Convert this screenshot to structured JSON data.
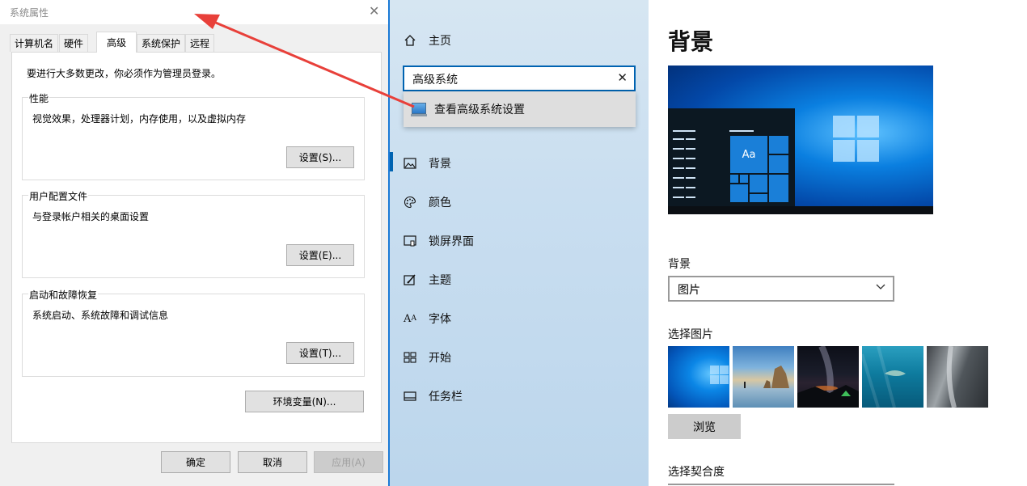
{
  "dialog": {
    "title": "系统属性",
    "tabs": [
      "计算机名",
      "硬件",
      "高级",
      "系统保护",
      "远程"
    ],
    "active_tab": "高级",
    "note": "要进行大多数更改，你必须作为管理员登录。",
    "groups": [
      {
        "title": "性能",
        "desc": "视觉效果，处理器计划，内存使用，以及虚拟内存",
        "button": "设置(S)..."
      },
      {
        "title": "用户配置文件",
        "desc": "与登录帐户相关的桌面设置",
        "button": "设置(E)..."
      },
      {
        "title": "启动和故障恢复",
        "desc": "系统启动、系统故障和调试信息",
        "button": "设置(T)..."
      }
    ],
    "env_button": "环境变量(N)...",
    "footer": {
      "ok": "确定",
      "cancel": "取消",
      "apply": "应用(A)"
    }
  },
  "settings": {
    "nav": {
      "home": "主页",
      "search_value": "高级系统",
      "suggestion": "查看高级系统设置",
      "items": [
        "背景",
        "颜色",
        "锁屏界面",
        "主题",
        "字体",
        "开始",
        "任务栏"
      ],
      "selected": "背景"
    },
    "main": {
      "heading": "背景",
      "preview_tile": "Aa",
      "background_label": "背景",
      "background_value": "图片",
      "choose_picture_label": "选择图片",
      "browse_label": "浏览",
      "fit_label": "选择契合度"
    }
  },
  "colors": {
    "accent": "#0063b1",
    "arrow": "#e8403a"
  }
}
